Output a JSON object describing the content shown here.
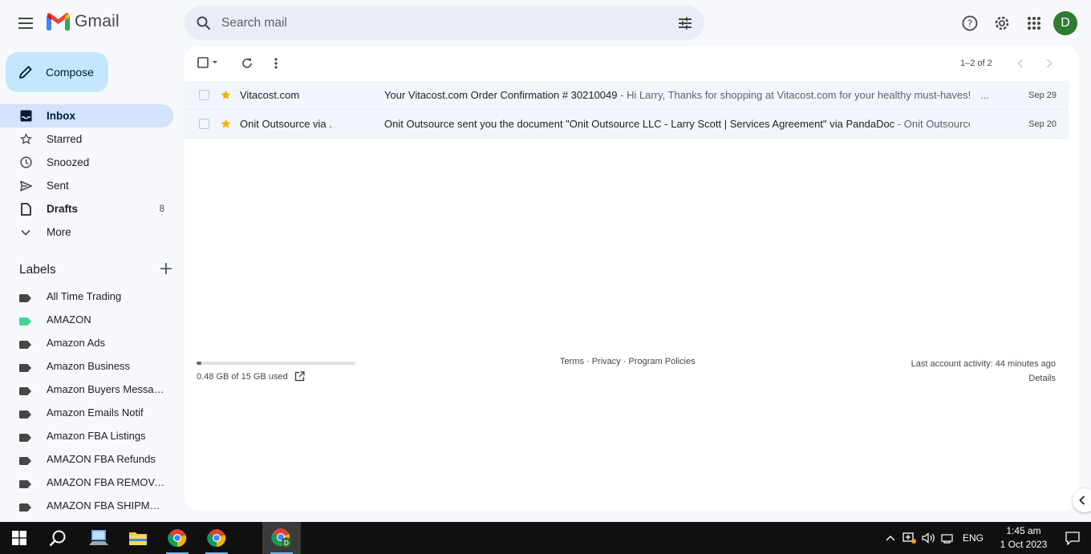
{
  "app": {
    "name": "Gmail",
    "avatar_letter": "D",
    "accent_color": "#c2e7ff"
  },
  "search": {
    "placeholder": "Search mail"
  },
  "compose": {
    "label": "Compose"
  },
  "sidebar": {
    "items": [
      {
        "label": "Inbox",
        "icon": "inbox-icon",
        "count": ""
      },
      {
        "label": "Starred",
        "icon": "star-icon",
        "count": ""
      },
      {
        "label": "Snoozed",
        "icon": "clock-icon",
        "count": ""
      },
      {
        "label": "Sent",
        "icon": "send-icon",
        "count": ""
      },
      {
        "label": "Drafts",
        "icon": "file-icon",
        "count": "8"
      },
      {
        "label": "More",
        "icon": "chevron-down-icon",
        "count": ""
      }
    ]
  },
  "labels": {
    "title": "Labels",
    "items": [
      {
        "label": "All Time Trading",
        "color": "#444746"
      },
      {
        "label": "AMAZON",
        "color": "#43d692"
      },
      {
        "label": "Amazon Ads",
        "color": "#444746"
      },
      {
        "label": "Amazon Business",
        "color": "#444746"
      },
      {
        "label": "Amazon Buyers Messag...",
        "color": "#444746"
      },
      {
        "label": "Amazon Emails Notif",
        "color": "#444746"
      },
      {
        "label": "Amazon FBA Listings",
        "color": "#444746"
      },
      {
        "label": "AMAZON FBA Refunds",
        "color": "#444746"
      },
      {
        "label": "AMAZON FBA REMOVAL",
        "color": "#444746"
      },
      {
        "label": "AMAZON FBA SHIPMEN...",
        "color": "#444746"
      }
    ]
  },
  "toolbar": {
    "pager": "1–2 of 2"
  },
  "emails": [
    {
      "sender": "Vitacost.com",
      "subject": "Your Vitacost.com Order Confirmation # 30210049",
      "snippet": " - Hi Larry, Thanks for shopping at Vitacost.com for your healthy must-haves!",
      "more": "...",
      "date": "Sep 29"
    },
    {
      "sender": "Onit Outsource via .",
      "subject": "Onit Outsource sent you the document \"Onit Outsource LLC - Larry Scott | Services Agreement\" via PandaDoc",
      "snippet": " - Onit Outsource s...",
      "more": "",
      "date": "Sep 20"
    }
  ],
  "footer": {
    "storage_text": "0.48 GB of 15 GB used",
    "storage_fraction": 0.032,
    "links": "Terms · Privacy · Program Policies",
    "activity": "Last account activity: 44 minutes ago",
    "details": "Details"
  },
  "taskbar": {
    "lang": "ENG",
    "time": "1:45 am",
    "date": "1 Oct 2023"
  }
}
